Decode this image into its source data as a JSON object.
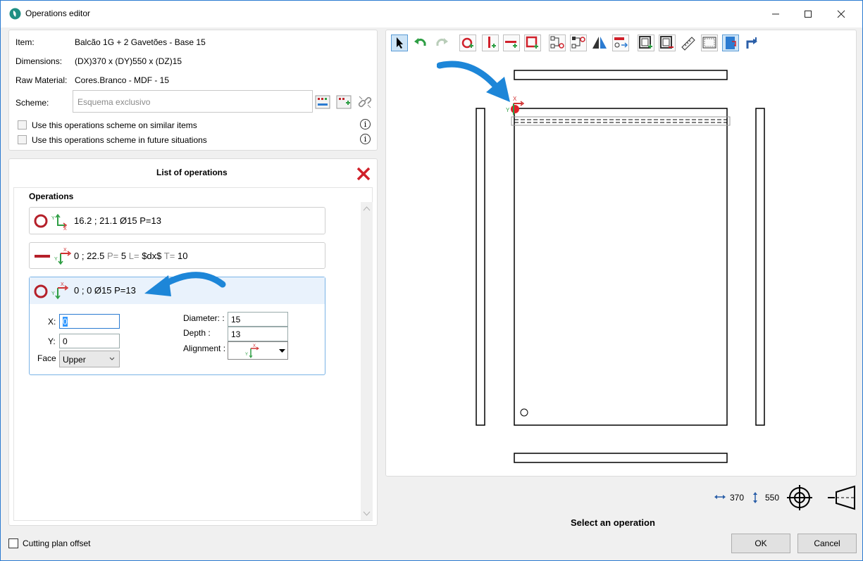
{
  "window": {
    "title": "Operations editor"
  },
  "item_info": {
    "item_label": "Item:",
    "item_value": "Balcão 1G + 2 Gavetões - Base 15",
    "dimensions_label": "Dimensions:",
    "dimensions_value": "(DX)370 x (DY)550 x (DZ)15",
    "raw_material_label": "Raw Material:",
    "raw_material_value": "Cores.Branco - MDF - 15",
    "scheme_label": "Scheme:",
    "scheme_placeholder": "Esquema exclusivo",
    "similar_items_label": "Use this operations scheme on similar items",
    "future_label": "Use this operations scheme in future situations"
  },
  "operations": {
    "panel_title": "List of operations",
    "section_title": "Operations",
    "items": [
      {
        "text": "16.2 ; 21.1 Ø15 P=13"
      },
      {
        "coord": "0 ; 22.5",
        "p_label": "P=",
        "p_value": "5",
        "l_label": "L=",
        "l_value": "$dx$",
        "t_label": "T=",
        "t_value": "10"
      },
      {
        "text": "0 ; 0 Ø15 P=13"
      }
    ],
    "editor": {
      "x_label": "X:",
      "x_value": "0",
      "y_label": "Y:",
      "y_value": "0",
      "face_label": "Face :",
      "face_value": "Upper",
      "diameter_label": "Diameter: :",
      "diameter_value": "15",
      "depth_label": "Depth :",
      "depth_value": "13",
      "alignment_label": "Alignment :"
    }
  },
  "canvas": {
    "dim_x": "370",
    "dim_y": "550",
    "status": "Select an operation"
  },
  "footer": {
    "cutting_plan_label": "Cutting plan offset",
    "ok_label": "OK",
    "cancel_label": "Cancel"
  },
  "colors": {
    "accent": "#2b7bd1",
    "red": "#c0282e",
    "green": "#2e9e44",
    "selected_card": "#e9f2fc"
  }
}
